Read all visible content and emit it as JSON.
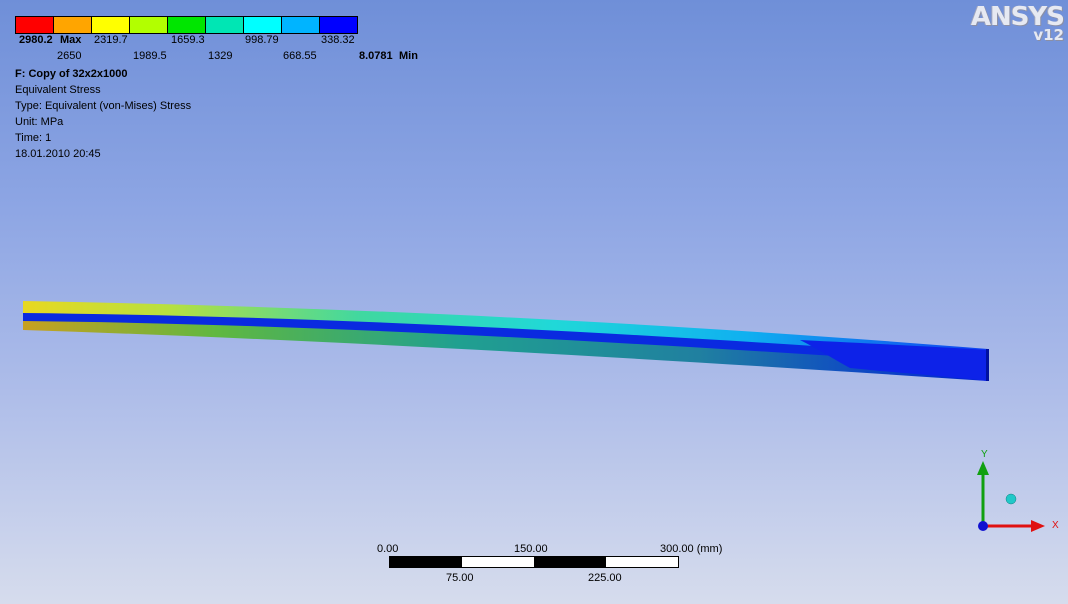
{
  "logo": {
    "name": "ANSYS",
    "version": "v12"
  },
  "legend": {
    "colors": [
      "#ff0000",
      "#ffa500",
      "#ffff00",
      "#b2ff00",
      "#00e600",
      "#00e6b4",
      "#00ffff",
      "#00b4ff",
      "#0000ff"
    ],
    "top_labels": {
      "max_value": "2980.2",
      "max_suffix": "Max",
      "l2": "2319.7",
      "l3": "1659.3",
      "l4": "998.79",
      "l5": "338.32"
    },
    "bottom_labels": {
      "b1": "2650",
      "b2": "1989.5",
      "b3": "1329",
      "b4": "668.55",
      "min_value": "8.0781",
      "min_suffix": "Min"
    }
  },
  "info": {
    "title": "F: Copy of 32x2x1000",
    "result": "Equivalent Stress",
    "type": "Type: Equivalent (von-Mises) Stress",
    "unit": "Unit: MPa",
    "time": "Time: 1",
    "date": "18.01.2010 20:45"
  },
  "scale_bar": {
    "top_labels": {
      "zero": "0.00",
      "mid": "150.00",
      "end": "300.00 (mm)"
    },
    "bottom_labels": {
      "q1": "75.00",
      "q3": "225.00"
    }
  },
  "triad": {
    "x_label": "X",
    "y_label": "Y",
    "x_color": "#e01010",
    "y_color": "#10a010",
    "origin_color": "#1010d0",
    "iso_ball_color": "#20c8c8"
  }
}
